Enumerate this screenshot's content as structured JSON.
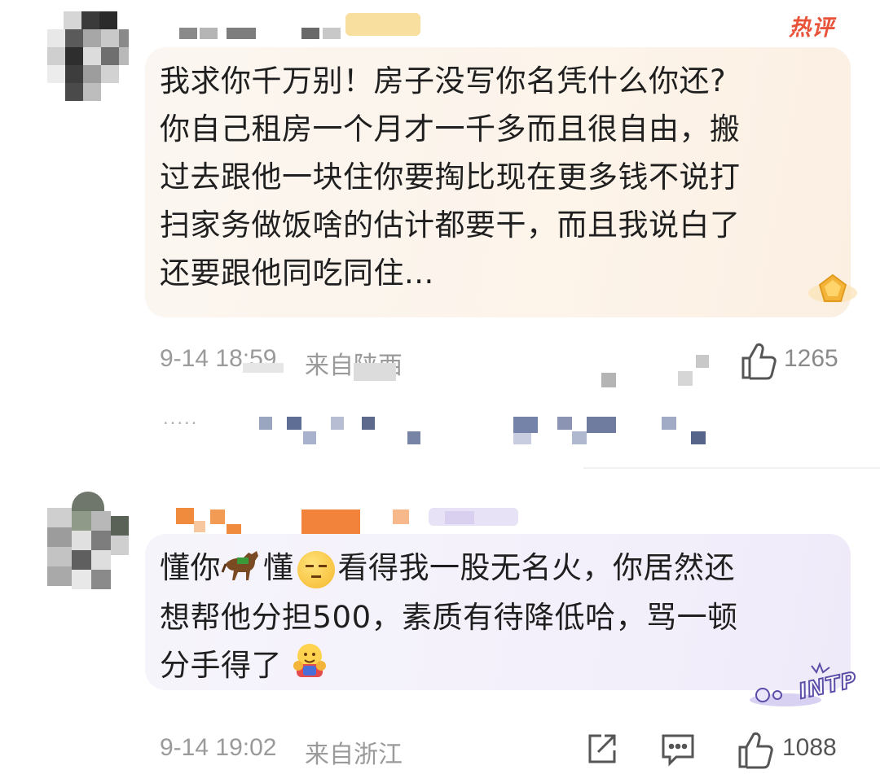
{
  "comments": [
    {
      "hot_label": "热评",
      "lines": [
        "我求你千万别！房子没写你名凭什么你还?",
        "你自己租房一个月才一千多而且很自由，搬",
        "过去跟他一块住你要掏比现在更多钱不说打",
        "扫家务做饭啥的估计都要干，而且我说白了",
        "还要跟他同吃同住..."
      ],
      "time": "9-14 18:59",
      "location": "来自陕西",
      "likes": "1265"
    },
    {
      "line1_a": "懂你",
      "line1_b": "懂",
      "line1_c": "看得我一股无名火，你居然还",
      "line2": "想帮他分担500，素质有待降低哈，骂一顿",
      "line3": "分手得了",
      "badge_text": "INTP",
      "time": "9-14 19:02",
      "location": "来自浙江",
      "likes": "1088"
    }
  ],
  "reply_row": {
    "more": "....."
  },
  "icons": {
    "share": "share-icon",
    "comment": "comment-icon",
    "like": "thumbs-up-icon",
    "horse": "horse-emoji",
    "face": "speechless-face-emoji",
    "hug": "hug-face-emoji",
    "gem": "gem-badge-icon"
  },
  "colors": {
    "hot": "#e8533a",
    "meta": "#9a9a9a",
    "bubble1": "#fcf3ea",
    "bubble2": "#f3f0fb",
    "badge": "#5b4ea8"
  }
}
